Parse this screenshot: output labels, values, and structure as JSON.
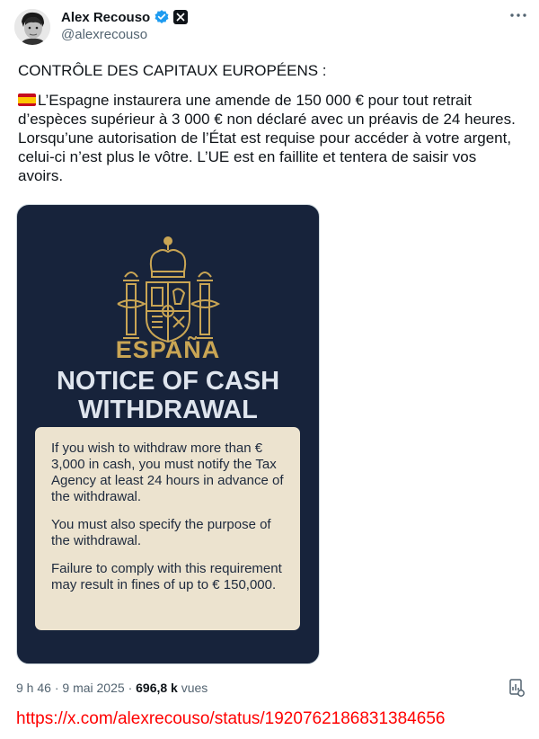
{
  "author": {
    "name": "Alex Recouso",
    "handle": "@alexrecouso"
  },
  "tweet": {
    "heading": "CONTRÔLE DES CAPITAUX EUROPÉENS :",
    "body": "L’Espagne instaurera une amende de 150 000 € pour tout retrait d’espèces supérieur à 3 000 € non déclaré avec un préavis de 24 heures. Lorsqu’une autorisation de l’État est requise pour accéder à votre argent, celui-ci n’est plus le vôtre. L’UE est en faillite et tentera de saisir vos avoirs."
  },
  "media": {
    "country": "ESPAÑA",
    "title_line1": "NOTICE OF CASH",
    "title_line2": "WITHDRAWAL",
    "paragraph1": "If you wish to withdraw more than € 3,000 in cash, you must notify the Tax Agency at least 24 hours in advance of the withdrawal.",
    "paragraph2": "You must also specify the purpose of the withdrawal.",
    "paragraph3": "Failure to comply with this requirement may result in fines of up to € 150,000.",
    "colors": {
      "background": "#17233b",
      "gold": "#c9a554",
      "paper": "#ece3cf"
    }
  },
  "footer": {
    "time": "9 h 46",
    "separator": "·",
    "date": "9 mai 2025",
    "views_count": "696,8 k",
    "views_label": "vues"
  },
  "source_link": "https://x.com/alexrecouso/status/1920762186831384656",
  "icons": {
    "verified": "verified-badge-icon",
    "x_affiliate": "x-logo-icon",
    "more": "more-icon",
    "stats": "view-stats-icon",
    "flag": "spain-flag-icon"
  }
}
